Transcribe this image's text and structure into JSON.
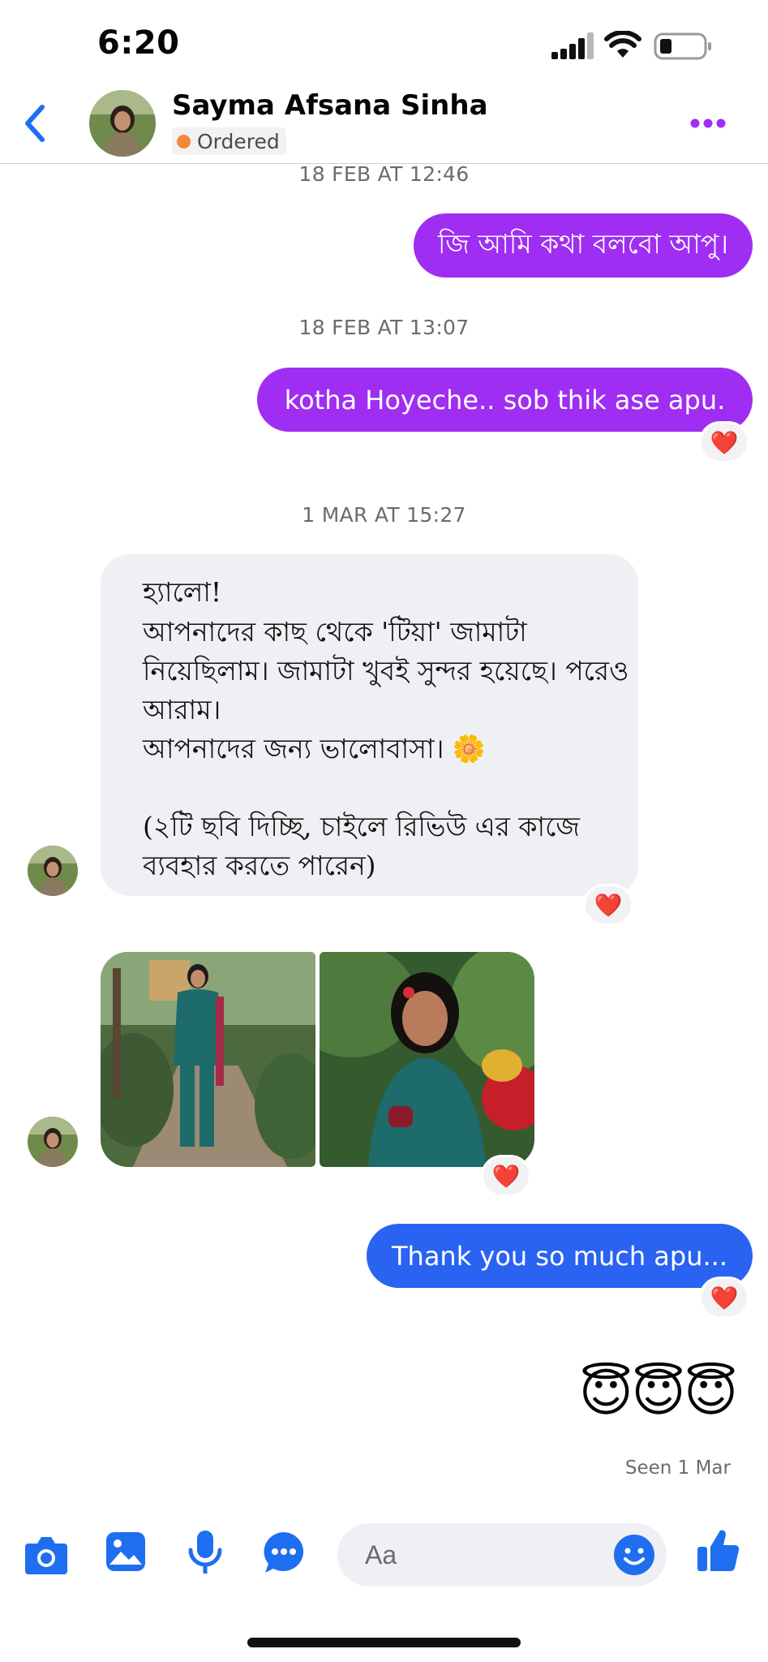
{
  "status_bar": {
    "time": "6:20",
    "icons": [
      "signal-icon",
      "wifi-icon",
      "battery-icon"
    ]
  },
  "header": {
    "back_icon": "chevron-left-icon",
    "contact_name": "Sayma Afsana Sinha",
    "status_label": "Ordered",
    "more_icon": "more-dots-icon"
  },
  "colors": {
    "accent_purple": "#a02df2",
    "accent_blue": "#2a63f2",
    "icon_blue": "#1e6ff0",
    "bubble_gray": "#eff0f3",
    "status_orange": "#f3893b"
  },
  "messages": [
    {
      "timestamp": "18 FEB AT 12:46",
      "text": "জি আমি কথা বলবো আপু।"
    },
    {
      "timestamp": "18 FEB AT 13:07",
      "text": "kotha Hoyeche.. sob thik ase apu.",
      "reaction": "❤️"
    },
    {
      "timestamp": "1 MAR AT 15:27",
      "lines": [
        "হ্যালো!",
        "আপনাদের কাছ থেকে 'টিয়া' জামাটা",
        "নিয়েছিলাম। জামাটা খুবই সুন্দর হয়েছে। পরেও",
        "আরাম।",
        "আপনাদের জন্য ভালোবাসা। 🌼",
        "",
        "(২টি ছবি দিচ্ছি, চাইলে রিভিউ এর কাজে",
        "ব্যবহার করতে পারেন)"
      ],
      "reaction": "❤️"
    },
    {
      "type": "photos",
      "count": 2,
      "reaction": "❤️"
    },
    {
      "text": "Thank you so much apu...",
      "reaction": "❤️"
    },
    {
      "emoji": "😇😇😇"
    }
  ],
  "seen_text": "Seen 1 Mar",
  "composer": {
    "placeholder": "Aa",
    "actions": [
      "camera-icon",
      "gallery-icon",
      "microphone-icon",
      "chat-more-icon"
    ],
    "emoji_icon": "emoji-icon",
    "like_icon": "thumbs-up-icon"
  }
}
